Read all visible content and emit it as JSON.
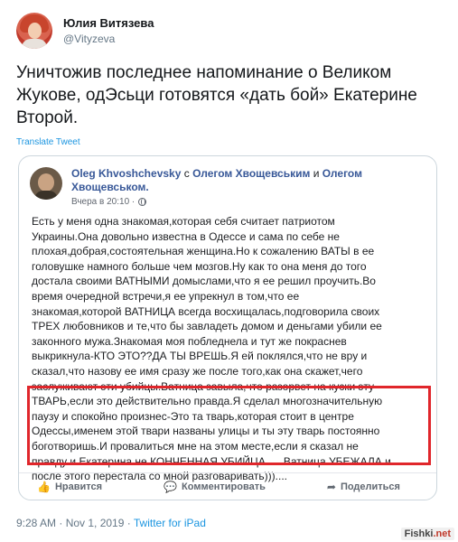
{
  "author": {
    "display_name": "Юлия Витязева",
    "handle": "@Vityzeva",
    "avatar_icon": "user-avatar-icon"
  },
  "tweet": {
    "text_line1": "Уничтожив последнее напоминание о Великом",
    "text_line2": "Жукове, одЭсьци готовятся «дать бой» Екатерине",
    "text_line3": "Второй.",
    "translate_label": "Translate Tweet"
  },
  "embedded_post": {
    "author": "Oleg Khvoshchevsky",
    "with_word": "с",
    "tag1": "Олегом Хвощевським",
    "and_word": "и",
    "tag2": "Олегом Хвощевськом.",
    "time": "Вчера в 20:10 ·",
    "body_lines": [
      "Есть у меня одна знакомая,которая себя считает патриотом",
      "Украины.Она довольно известна в Одессе и сама по себе не",
      "плохая,добрая,состоятельная женщина.Но к сожалению ВАТЫ в ее",
      "головушке намного больше чем мозгов.Ну как то она меня до того",
      "достала своими ВАТНЫМИ домыслами,что я ее решил проучить.Во",
      "время очередной встречи,я ее упрекнул в том,что ее",
      "знакомая,которой ВАТНИЦА всегда восхищалась,подговорила своих",
      "ТРЕХ любовников и те,что бы завладеть домом и деньгами убили ее",
      "законного  мужа.Знакомая моя побледнела и тут же покраснев",
      "выкрикнула-КТО ЭТО??ДА ТЫ ВРЕШЬ.Я ей поклялся,что не вру и",
      "сказал,что назову ее имя сразу же после того,как она скажет,чего",
      "заслуживают эти убийцы.Ватница завыла,что разорвет на куски эту",
      "ТВАРЬ,если это действительно правда.Я сделал многозначительную",
      "паузу и спокойно произнес-Это та тварь,которая стоит в центре",
      "Одессы,именем этой твари названы улицы и ты эту тварь постоянно",
      "боготворишь.И провалиться мне на этом месте,если я сказал не",
      "правду и Екатерина не КОНЧЕННАЯ УБИЙЦА......Ватница УБЕЖАЛА и",
      "после этого перестала со мной разговаривать)))...."
    ],
    "actions": {
      "like": "Нравится",
      "comment": "Комментировать",
      "share": "Поделиться"
    }
  },
  "footer": {
    "timestamp": "9:28 AM · Nov 1, 2019 · ",
    "source": "Twitter for iPad"
  },
  "watermark": {
    "name": "Fishki",
    "tld": ".net"
  },
  "colors": {
    "link_blue": "#1b95e0",
    "highlight_red": "#e0262b",
    "fb_blue": "#385898"
  }
}
